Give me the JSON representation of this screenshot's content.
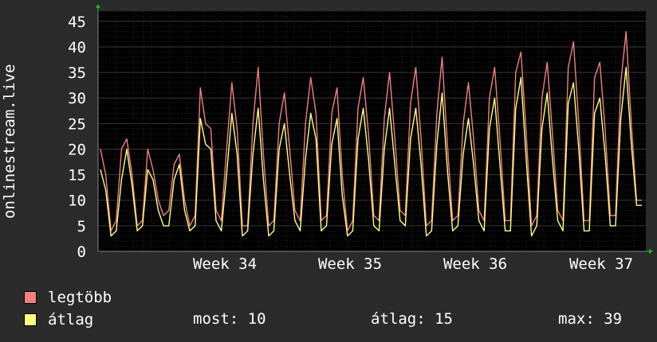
{
  "chart_data": {
    "type": "line",
    "ylabel": "onlinestream.live",
    "ylim": [
      0,
      47
    ],
    "y_ticks": [
      "0",
      "5",
      "10",
      "15",
      "20",
      "25",
      "30",
      "35",
      "40",
      "45"
    ],
    "x_ticks": [
      "Week 34",
      "Week 35",
      "Week 36",
      "Week 37"
    ],
    "grid": true,
    "series": [
      {
        "name": "legtöbb",
        "color": "#f08080",
        "values": [
          20,
          15,
          4,
          6,
          20,
          22,
          15,
          5,
          6,
          20,
          16,
          10,
          7,
          8,
          17,
          19,
          10,
          5,
          7,
          32,
          25,
          24,
          8,
          6,
          20,
          33,
          24,
          5,
          5,
          25,
          36,
          19,
          5,
          6,
          25,
          31,
          20,
          8,
          6,
          25,
          34,
          27,
          6,
          7,
          27,
          32,
          15,
          4,
          6,
          28,
          34,
          23,
          7,
          6,
          26,
          35,
          22,
          8,
          7,
          29,
          36,
          22,
          5,
          6,
          27,
          38,
          21,
          6,
          7,
          25,
          33,
          22,
          8,
          6,
          30,
          36,
          22,
          6,
          6,
          35,
          39,
          23,
          5,
          7,
          30,
          37,
          23,
          8,
          6,
          36,
          41,
          25,
          6,
          6,
          34,
          37,
          24,
          7,
          7,
          33,
          43,
          25,
          10,
          10
        ]
      },
      {
        "name": "átlag",
        "color": "#ffff80",
        "values": [
          16,
          12,
          3,
          4,
          14,
          20,
          13,
          4,
          5,
          16,
          14,
          8,
          5,
          5,
          14,
          17,
          8,
          4,
          5,
          26,
          21,
          20,
          6,
          4,
          15,
          27,
          19,
          3,
          4,
          19,
          28,
          14,
          3,
          4,
          20,
          25,
          15,
          6,
          4,
          18,
          27,
          22,
          4,
          5,
          21,
          26,
          11,
          3,
          4,
          22,
          28,
          18,
          5,
          4,
          20,
          28,
          17,
          6,
          5,
          22,
          28,
          17,
          3,
          4,
          21,
          31,
          16,
          4,
          5,
          19,
          26,
          17,
          6,
          4,
          24,
          30,
          17,
          4,
          4,
          28,
          34,
          18,
          3,
          5,
          24,
          31,
          18,
          6,
          4,
          29,
          33,
          20,
          4,
          4,
          27,
          30,
          19,
          5,
          5,
          26,
          36,
          21,
          9,
          9
        ]
      }
    ],
    "legend": [
      {
        "label": "legtöbb",
        "color": "#f08080"
      },
      {
        "label": "átlag",
        "color": "#ffff80"
      }
    ],
    "stats": {
      "most": "most: 10",
      "atlag": "átlag: 15",
      "max": "max: 39"
    }
  }
}
